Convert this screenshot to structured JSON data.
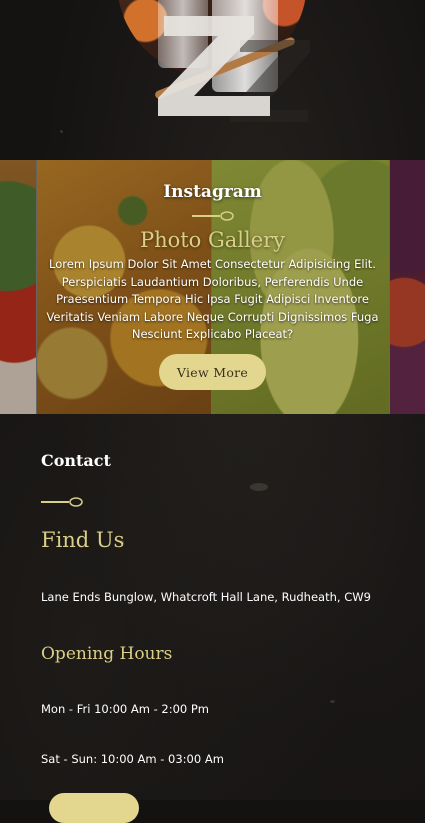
{
  "hero": {
    "logo_letter": "Z",
    "logo_alt": "restaurant-logo"
  },
  "gallery": {
    "eyebrow": "Instagram",
    "title": "Photo Gallery",
    "body": "Lorem Ipsum Dolor Sit Amet Consectetur Adipisicing Elit. Perspiciatis Laudantium Doloribus, Perferendis Unde Praesentium Tempora Hic Ipsa Fugit Adipisci Inventore Veritatis Veniam Labore Neque Corrupti Dignissimos Fuga Nesciunt Explicabo Placeat?",
    "button_label": "View More"
  },
  "contact": {
    "eyebrow": "Contact",
    "title": "Find Us",
    "address": "Lane Ends Bunglow, Whatcroft Hall Lane, Rudheath, CW9",
    "hours_title": "Opening Hours",
    "hours": [
      "Mon - Fri 10:00 Am - 2:00 Pm",
      "Sat - Sun: 10:00 Am - 03:00 Am"
    ]
  },
  "colors": {
    "accent_gold": "#d9cf86",
    "button_bg": "#e3d68f",
    "background": "#151312",
    "text": "#ffffff"
  }
}
